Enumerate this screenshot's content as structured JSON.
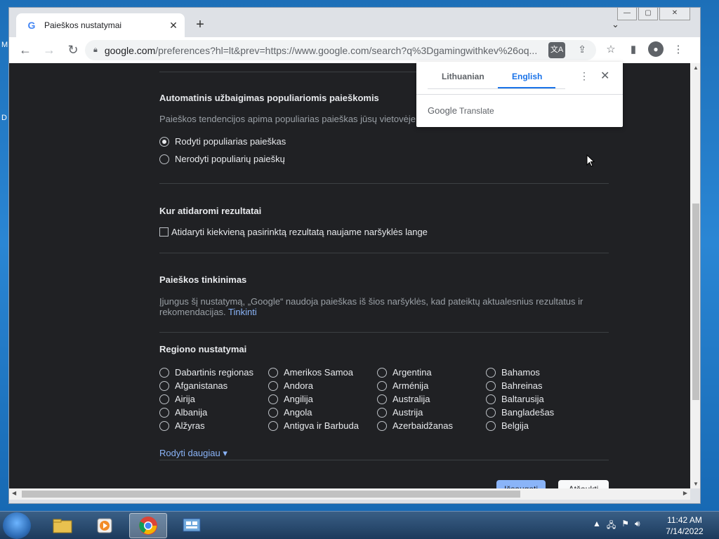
{
  "desktop": {
    "edge_letters": [
      "M",
      "D"
    ]
  },
  "browser": {
    "tab_title": "Paieškos nustatymai",
    "tab_close": "✕",
    "new_tab": "+",
    "tab_search": "⌄",
    "url_host": "google.com",
    "url_rest": "/preferences?hl=lt&prev=https://www.google.com/search?q%3Dgamingwithkev%26oq...",
    "window_buttons": [
      "—",
      "▢",
      "✕"
    ]
  },
  "page": {
    "autocomplete": {
      "heading": "Automatinis užbaigimas populiariomis paieškomis",
      "desc": "Paieškos tendencijos apima populiarias paieškas jūsų vietovėje",
      "options": [
        {
          "label": "Rodyti populiarias paieškas",
          "selected": true
        },
        {
          "label": "Nerodyti populiarių paieškų",
          "selected": false
        }
      ]
    },
    "results_open": {
      "heading": "Kur atidaromi rezultatai",
      "checkbox_label": "Atidaryti kiekvieną pasirinktą rezultatą naujame naršyklės lange"
    },
    "personalization": {
      "heading": "Paieškos tinkinimas",
      "desc_line1": "Įjungus šį nustatymą, „Google“ naudoja paieškas iš šios naršyklės, kad pateiktų aktualesnius rezultatus ir",
      "desc_line2": "rekomendacijas.",
      "link": "Tinkinti"
    },
    "region": {
      "heading": "Regiono nustatymai",
      "items": [
        "Dabartinis regionas",
        "Amerikos Samoa",
        "Argentina",
        "Bahamos",
        "Afganistanas",
        "Andora",
        "Arménija",
        "Bahreinas",
        "Airija",
        "Angilija",
        "Australija",
        "Baltarusija",
        "Albanija",
        "Angola",
        "Austrija",
        "Bangladešas",
        "Alžyras",
        "Antigva ir Barbuda",
        "Azerbaidžanas",
        "Belgija"
      ],
      "more": "Rodyti daugiau ▾"
    },
    "save_button": "Išsaugoti",
    "cancel_button": "Atšaukti"
  },
  "translate_popup": {
    "source_lang": "Lithuanian",
    "target_lang": "English",
    "brand_google": "Google",
    "brand_translate": "Translate"
  },
  "taskbar": {
    "time": "11:42 AM",
    "date": "7/14/2022"
  }
}
